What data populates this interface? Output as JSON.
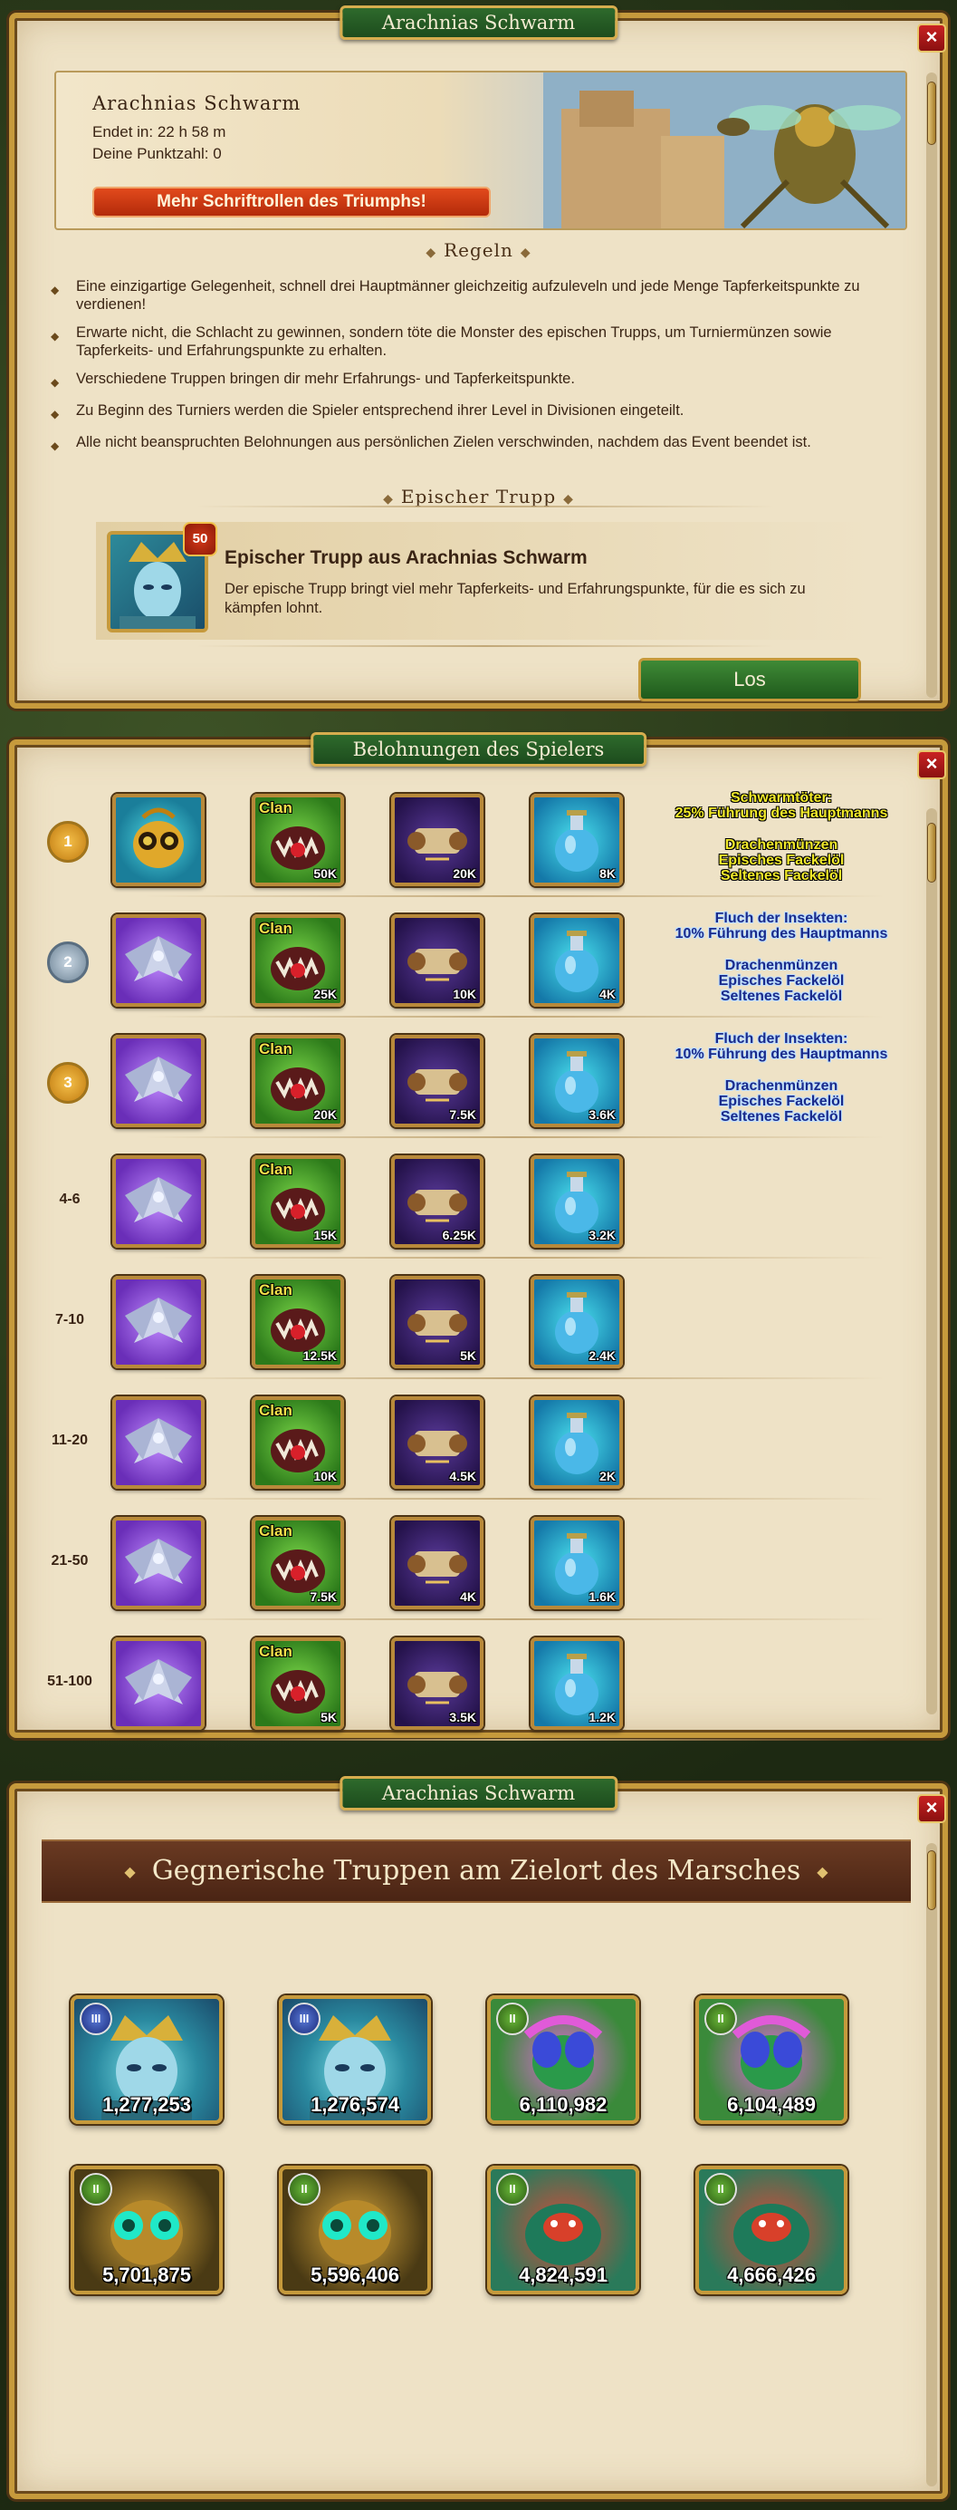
{
  "panel1": {
    "title": "Arachnias Schwarm",
    "close": "×",
    "banner": {
      "heading": "Arachnias Schwarm",
      "ends_in": "Endet in: 22 h   58 m",
      "points": "Deine Punktzahl: 0",
      "more_button": "Mehr Schriftrollen des Triumphs!"
    },
    "rules_heading": "Regeln",
    "rules": [
      "Eine einzigartige Gelegenheit, schnell drei Hauptmänner gleichzeitig aufzuleveln und jede Menge Tapferkeitspunkte zu verdienen!",
      "Erwarte nicht, die Schlacht zu gewinnen, sondern töte die Monster des epischen Trupps, um Turniermünzen sowie Tapferkeits- und Erfahrungspunkte zu erhalten.",
      "Verschiedene Truppen bringen dir mehr Erfahrungs- und Tapferkeitspunkte.",
      "Zu Beginn des Turniers werden die Spieler entsprechend ihrer Level in Divisionen eingeteilt.",
      "Alle nicht beanspruchten Belohnungen aus persönlichen Zielen verschwinden, nachdem das Event beendet ist."
    ],
    "epic_heading": "Epischer Trupp",
    "epic": {
      "level": "50",
      "name": "Epischer Trupp aus Arachnias Schwarm",
      "description": "Der epische Trupp bringt viel mehr Tapferkeits- und Erfahrungspunkte, für die es sich zu kämpfen lohnt."
    },
    "go_button": "Los"
  },
  "panel2": {
    "title": "Belohnungen des Spielers",
    "close": "×",
    "clan_label": "Clan",
    "rows": [
      {
        "rank": "1",
        "badge": "gold",
        "first": "bg-gold",
        "clan": "50K",
        "scroll": "20K",
        "potion": "8K",
        "bonus_title": "Schwarmtöter:\n25% Führung des Hauptmanns",
        "bonus_items": "Drachenmünzen\nEpisches Fackelöl\nSeltenes Fackelöl",
        "bonus_style": "yellow"
      },
      {
        "rank": "2",
        "badge": "silver",
        "first": "bg-purple",
        "clan": "25K",
        "scroll": "10K",
        "potion": "4K",
        "bonus_title": "Fluch der Insekten:\n10% Führung des Hauptmanns",
        "bonus_items": "Drachenmünzen\nEpisches Fackelöl\nSeltenes Fackelöl",
        "bonus_style": "blue"
      },
      {
        "rank": "3",
        "badge": "gold",
        "first": "bg-purple",
        "clan": "20K",
        "scroll": "7.5K",
        "potion": "3.6K",
        "bonus_title": "Fluch der Insekten:\n10% Führung des Hauptmanns",
        "bonus_items": "Drachenmünzen\nEpisches Fackelöl\nSeltenes Fackelöl",
        "bonus_style": "blue"
      },
      {
        "rank": "4-6",
        "badge": "",
        "first": "bg-purple",
        "clan": "15K",
        "scroll": "6.25K",
        "potion": "3.2K",
        "bonus_title": "",
        "bonus_items": "",
        "bonus_style": ""
      },
      {
        "rank": "7-10",
        "badge": "",
        "first": "bg-purple",
        "clan": "12.5K",
        "scroll": "5K",
        "potion": "2.4K",
        "bonus_title": "",
        "bonus_items": "",
        "bonus_style": ""
      },
      {
        "rank": "11-20",
        "badge": "",
        "first": "bg-purple",
        "clan": "10K",
        "scroll": "4.5K",
        "potion": "2K",
        "bonus_title": "",
        "bonus_items": "",
        "bonus_style": ""
      },
      {
        "rank": "21-50",
        "badge": "",
        "first": "bg-purple",
        "clan": "7.5K",
        "scroll": "4K",
        "potion": "1.6K",
        "bonus_title": "",
        "bonus_items": "",
        "bonus_style": ""
      },
      {
        "rank": "51-100",
        "badge": "",
        "first": "bg-purple",
        "clan": "5K",
        "scroll": "3.5K",
        "potion": "1.2K",
        "bonus_title": "",
        "bonus_items": "",
        "bonus_style": ""
      }
    ]
  },
  "panel3": {
    "title": "Arachnias Schwarm",
    "close": "×",
    "heading": "Gegnerische Truppen am Zielort des Marsches",
    "enemies": [
      {
        "tier": "III",
        "tier_color": "blue",
        "kind": "queen",
        "power": "1,277,253"
      },
      {
        "tier": "III",
        "tier_color": "blue",
        "kind": "queen",
        "power": "1,276,574"
      },
      {
        "tier": "II",
        "tier_color": "green",
        "kind": "mantis",
        "power": "6,110,982"
      },
      {
        "tier": "II",
        "tier_color": "green",
        "kind": "mantis",
        "power": "6,104,489"
      },
      {
        "tier": "II",
        "tier_color": "green",
        "kind": "wasp",
        "power": "5,701,875"
      },
      {
        "tier": "II",
        "tier_color": "green",
        "kind": "wasp",
        "power": "5,596,406"
      },
      {
        "tier": "II",
        "tier_color": "green",
        "kind": "beetle",
        "power": "4,824,591"
      },
      {
        "tier": "II",
        "tier_color": "green",
        "kind": "beetle",
        "power": "4,666,426"
      }
    ]
  },
  "colors": {
    "parchment": "#eee2c6",
    "gold_frame": "#c69a3c",
    "title_green": "#2e6a2c",
    "orange_button": "#e24a1c",
    "close_red": "#c92222"
  }
}
